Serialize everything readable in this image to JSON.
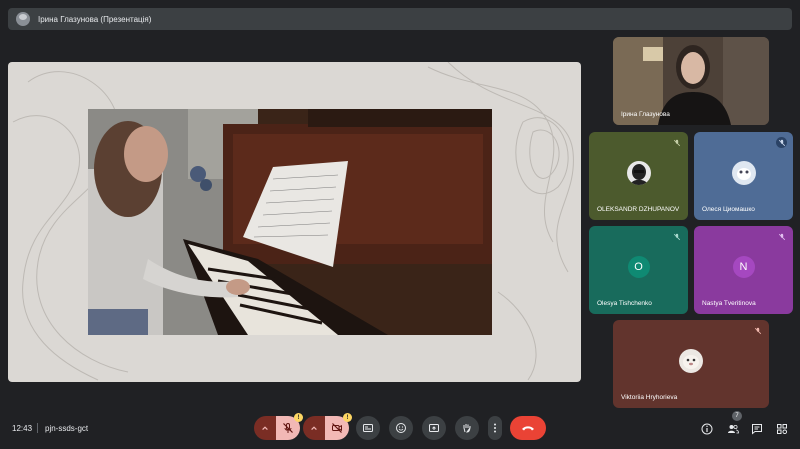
{
  "presenter_bar": {
    "title": "Ірина Глазунова (Презентація)"
  },
  "participants": [
    {
      "name": "Ірина Глазунова",
      "muted": false
    },
    {
      "name": "OLEKSANDR DZHUPANOV",
      "muted": true,
      "color": "#4c5a2d"
    },
    {
      "name": "Олеся Циомашко",
      "muted": true,
      "color": "#4f6c96"
    },
    {
      "name": "Olesya Tishchenko",
      "muted": true,
      "color": "#186b5c",
      "initial": "O"
    },
    {
      "name": "Nastya Tveritinova",
      "muted": true,
      "color": "#8a3a9e",
      "initial": "N"
    },
    {
      "name": "Viktoriia Hryhorieva",
      "muted": true,
      "color": "#62342d"
    }
  ],
  "meeting": {
    "time": "12:43",
    "code": "pjn-ssds-gct",
    "participant_count": "7"
  },
  "controls": {
    "mic": "mic-off-icon",
    "camera": "camera-off-icon",
    "captions": "captions-icon",
    "emoji": "emoji-icon",
    "present": "present-icon",
    "hand": "raise-hand-icon",
    "more": "more-vert-icon",
    "end_call": "end-call-icon"
  },
  "colors": {
    "end_call": "#ea4335",
    "muted_badge": "#f2b8b5",
    "warning": "#fdd663"
  }
}
